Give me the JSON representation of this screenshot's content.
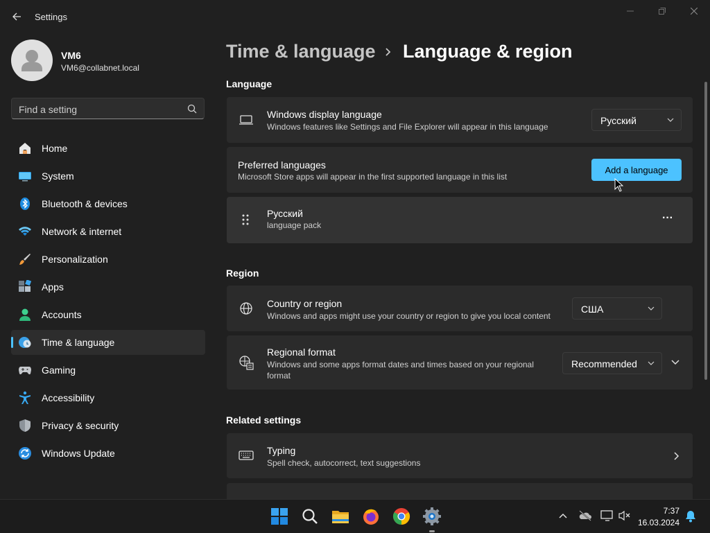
{
  "window": {
    "title": "Settings"
  },
  "user": {
    "name": "VM6",
    "email": "VM6@collabnet.local"
  },
  "search": {
    "placeholder": "Find a setting"
  },
  "sidebar": {
    "items": [
      {
        "label": "Home",
        "icon": "home-icon"
      },
      {
        "label": "System",
        "icon": "system-icon"
      },
      {
        "label": "Bluetooth & devices",
        "icon": "bluetooth-icon"
      },
      {
        "label": "Network & internet",
        "icon": "wifi-icon"
      },
      {
        "label": "Personalization",
        "icon": "brush-icon"
      },
      {
        "label": "Apps",
        "icon": "apps-icon"
      },
      {
        "label": "Accounts",
        "icon": "accounts-icon"
      },
      {
        "label": "Time & language",
        "icon": "clock-globe-icon",
        "active": true
      },
      {
        "label": "Gaming",
        "icon": "gamepad-icon"
      },
      {
        "label": "Accessibility",
        "icon": "accessibility-icon"
      },
      {
        "label": "Privacy & security",
        "icon": "shield-icon"
      },
      {
        "label": "Windows Update",
        "icon": "update-icon"
      }
    ]
  },
  "breadcrumb": {
    "parent": "Time & language",
    "current": "Language & region"
  },
  "language": {
    "section": "Language",
    "display": {
      "title": "Windows display language",
      "subtitle": "Windows features like Settings and File Explorer will appear in this language",
      "value": "Русский"
    },
    "preferred": {
      "title": "Preferred languages",
      "subtitle": "Microsoft Store apps will appear in the first supported language in this list",
      "button": "Add a language"
    },
    "installed": [
      {
        "name": "Русский",
        "detail": "language pack",
        "more": "···"
      }
    ]
  },
  "region": {
    "section": "Region",
    "country": {
      "title": "Country or region",
      "subtitle": "Windows and apps might use your country or region to give you local content",
      "value": "США"
    },
    "format": {
      "title": "Regional format",
      "subtitle_line1": "Windows and some apps format dates and times based on your regional",
      "subtitle_line2": "format",
      "value": "Recommended"
    }
  },
  "related": {
    "section": "Related settings",
    "typing": {
      "title": "Typing",
      "subtitle": "Spell check, autocorrect, text suggestions"
    }
  },
  "taskbar": {
    "apps": [
      "windows-start-icon",
      "search-icon",
      "file-explorer-icon",
      "firefox-icon",
      "chrome-icon",
      "settings-icon"
    ],
    "time": "7:37",
    "date": "16.03.2024"
  },
  "colors": {
    "accent": "#4cc2ff",
    "background": "#202020",
    "card": "#2b2b2b"
  }
}
